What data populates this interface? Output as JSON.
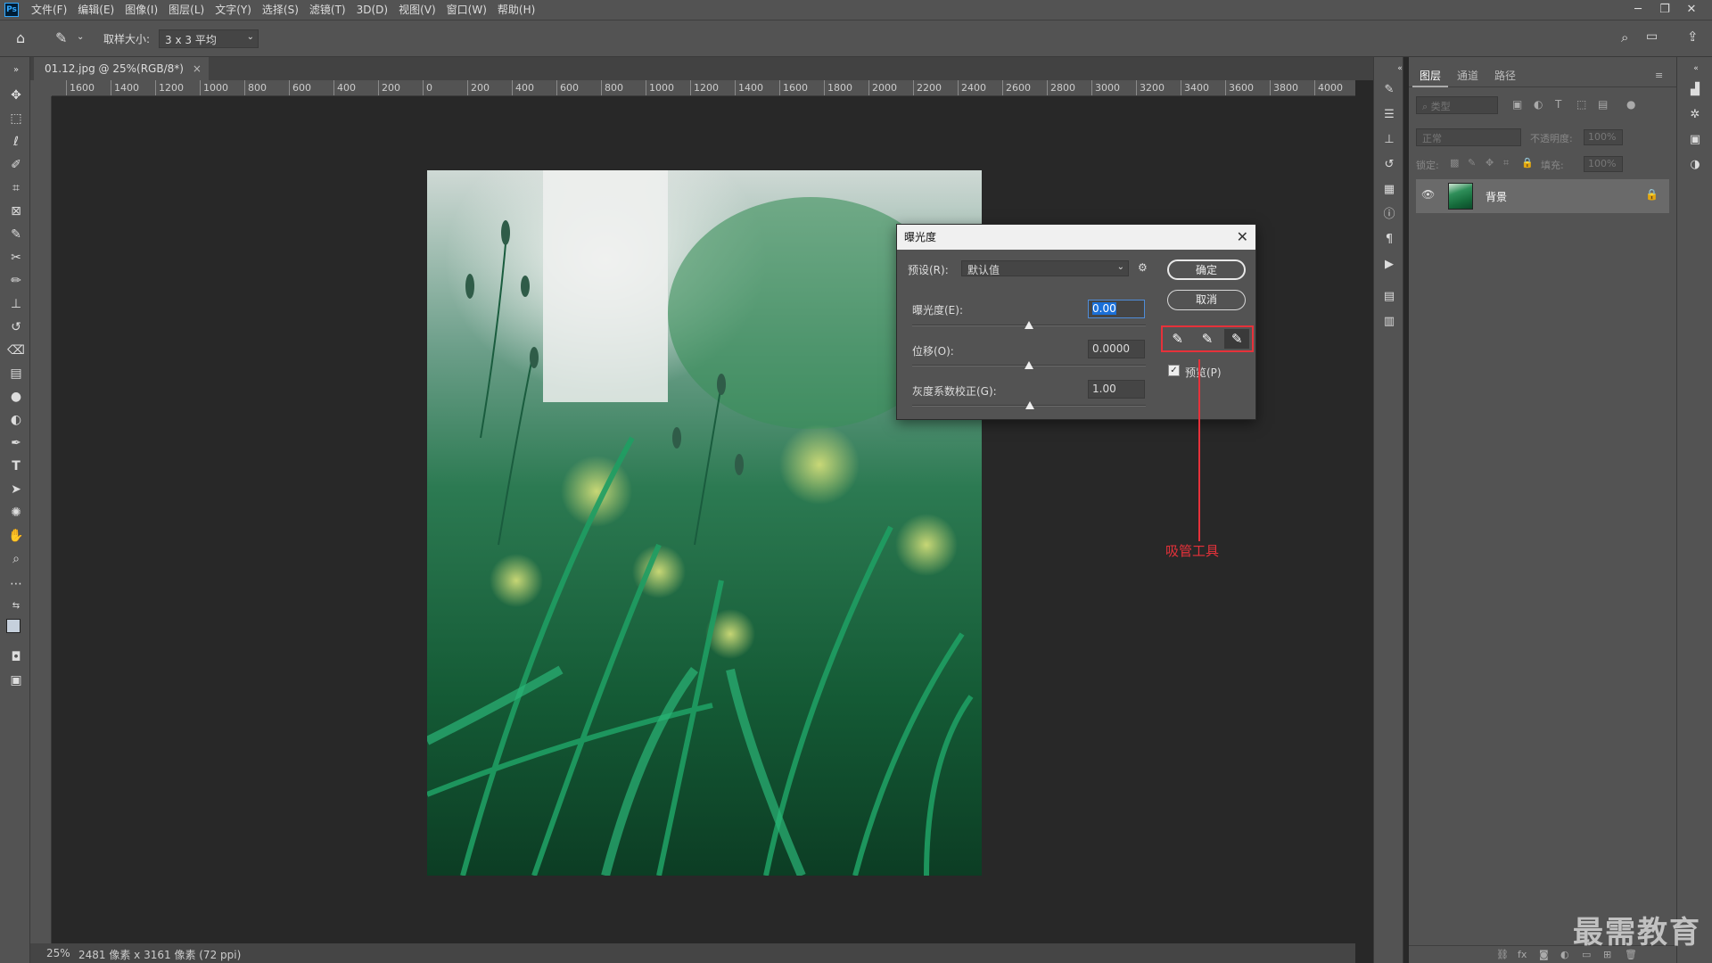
{
  "app": {
    "logo": "Ps"
  },
  "menu": [
    "文件(F)",
    "编辑(E)",
    "图像(I)",
    "图层(L)",
    "文字(Y)",
    "选择(S)",
    "滤镜(T)",
    "3D(D)",
    "视图(V)",
    "窗口(W)",
    "帮助(H)"
  ],
  "options": {
    "sample_label": "取样大小:",
    "sample_value": "3 x 3 平均"
  },
  "document": {
    "tab_label": "01.12.jpg @ 25%(RGB/8*)",
    "zoom": "25%",
    "info": "2481 像素 x 3161 像素 (72 ppi)"
  },
  "ruler_top_labels": [
    "1600",
    "1400",
    "1200",
    "1000",
    "800",
    "600",
    "400",
    "200",
    "0",
    "200",
    "400",
    "600",
    "800",
    "1000",
    "1200",
    "1400",
    "1600",
    "1800",
    "2000",
    "2200",
    "2400",
    "2600",
    "2800",
    "3000",
    "3200",
    "3400",
    "3600",
    "3800",
    "4000"
  ],
  "dialog": {
    "title": "曝光度",
    "preset_label": "预设(R):",
    "preset_value": "默认值",
    "exposure_label": "曝光度(E):",
    "exposure_value": "0.00",
    "offset_label": "位移(O):",
    "offset_value": "0.0000",
    "gamma_label": "灰度系数校正(G):",
    "gamma_value": "1.00",
    "ok_label": "确定",
    "cancel_label": "取消",
    "preview_label": "预览(P)",
    "preview_checked": true
  },
  "annotation": {
    "text": "吸管工具",
    "color": "#e6313a"
  },
  "layers_panel": {
    "tabs": [
      "图层",
      "通道",
      "路径"
    ],
    "kind_placeholder": "类型",
    "blend_mode": "正常",
    "opacity_label": "不透明度:",
    "opacity_value": "100%",
    "lock_label": "锁定:",
    "fill_label": "填充:",
    "fill_value": "100%",
    "layers": [
      {
        "name": "背景",
        "visible": true,
        "locked": true
      }
    ]
  },
  "watermark": "最需教育"
}
